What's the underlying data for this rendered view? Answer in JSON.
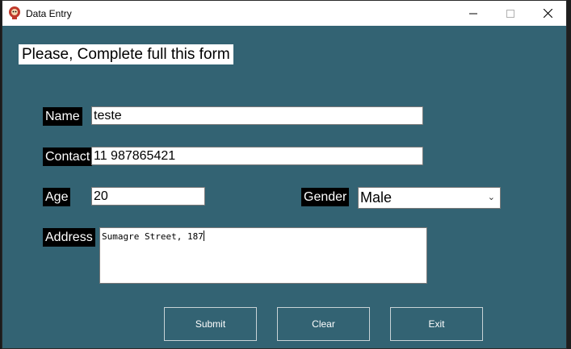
{
  "window": {
    "title": "Data Entry",
    "min_icon": "minimize-icon",
    "max_icon": "maximize-icon",
    "close_icon": "close-icon",
    "background": "#336373"
  },
  "form": {
    "heading": "Please, Complete full this form",
    "name_label": "Name",
    "name_value": "teste",
    "contact_label": "Contact",
    "contact_value": "11 987865421",
    "age_label": "Age",
    "age_value": "20",
    "gender_label": "Gender",
    "gender_value": "Male",
    "address_label": "Address",
    "address_value": "Sumagre Street, 187"
  },
  "buttons": {
    "submit": "Submit",
    "clear": "Clear",
    "exit": "Exit"
  }
}
